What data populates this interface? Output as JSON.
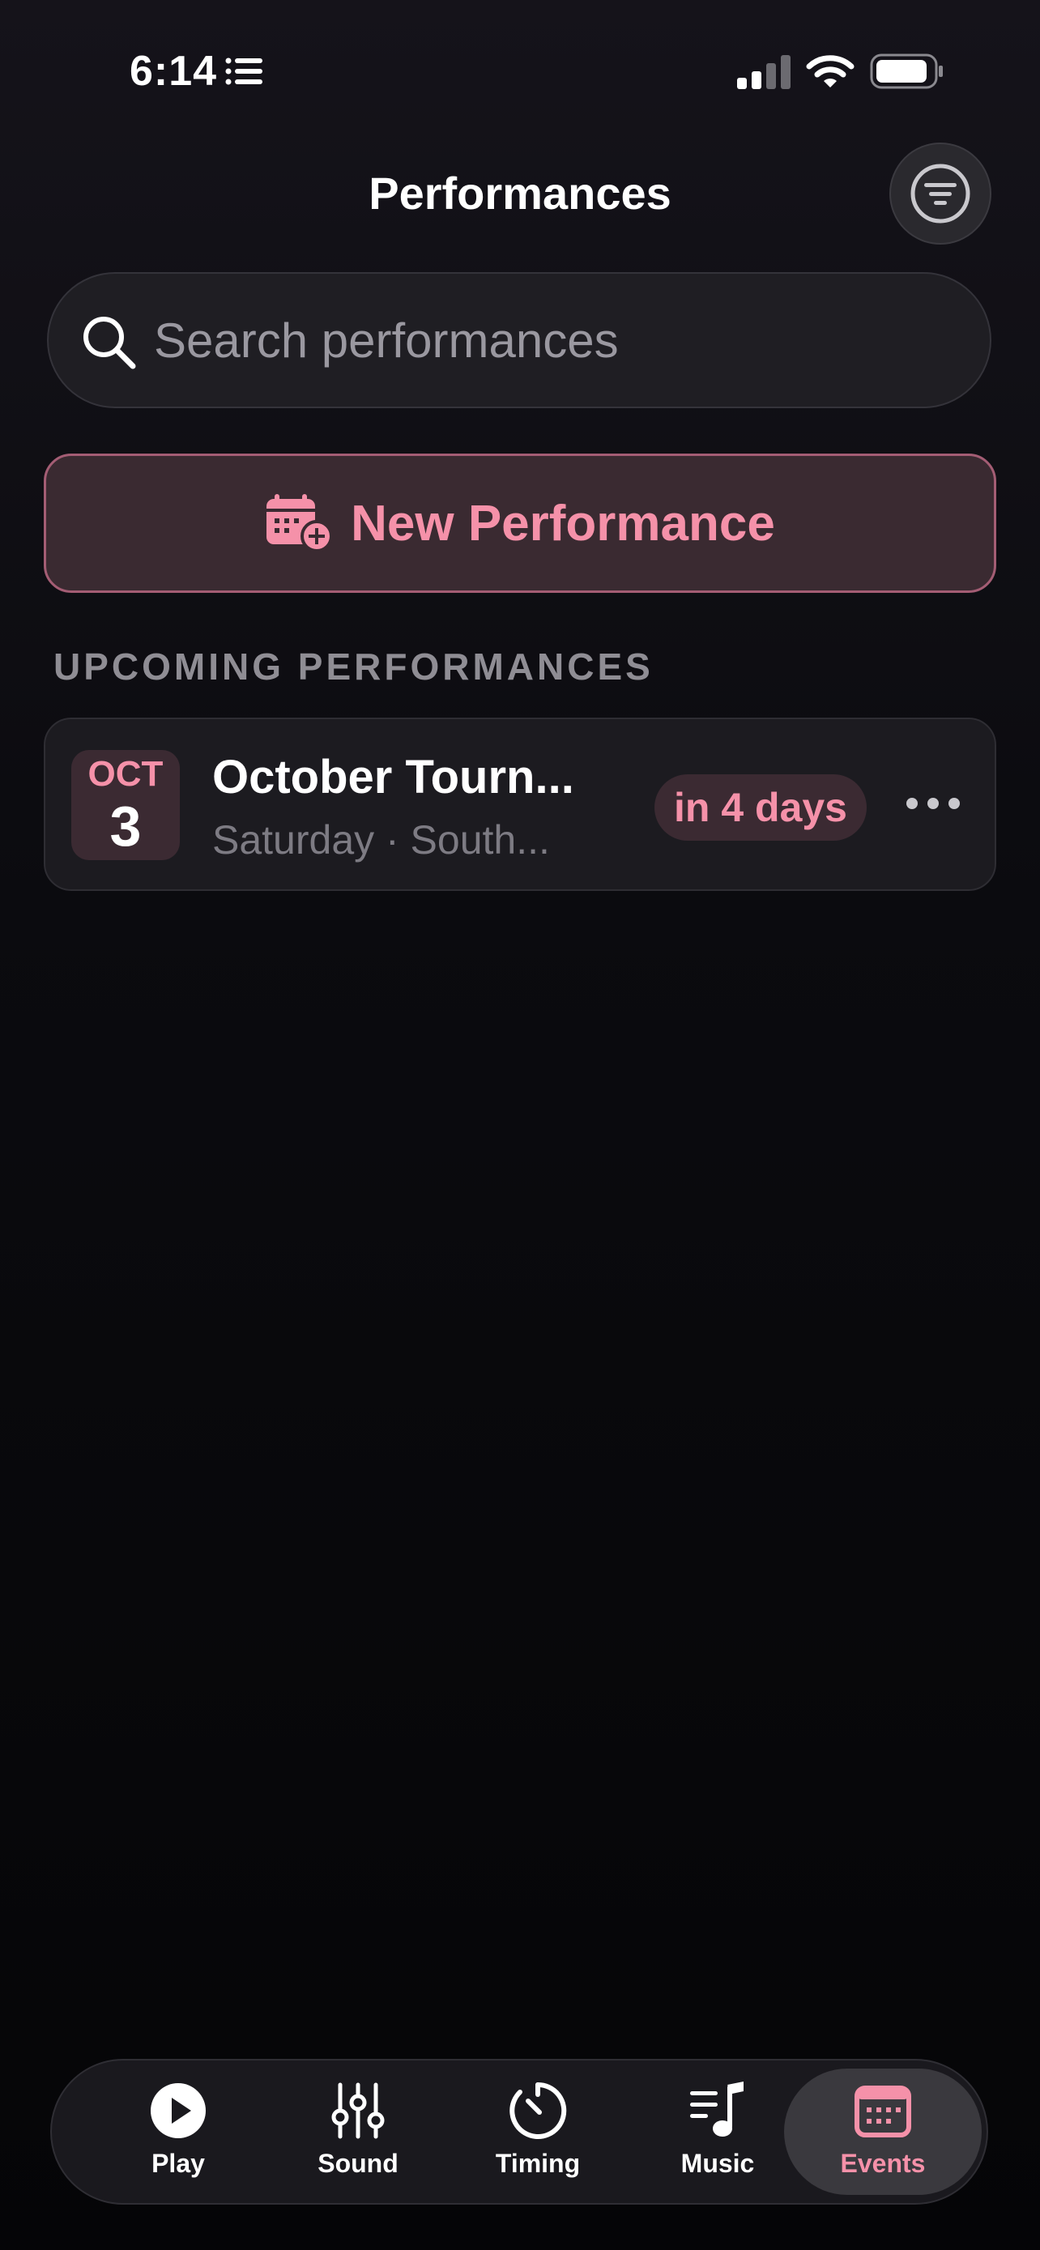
{
  "status_bar": {
    "time": "6:14"
  },
  "header": {
    "title": "Performances"
  },
  "search": {
    "placeholder": "Search performances"
  },
  "new_performance": {
    "label": "New Performance"
  },
  "sections": {
    "upcoming": "UPCOMING PERFORMANCES"
  },
  "performances": [
    {
      "month": "OCT",
      "day": "3",
      "title": "October Tourn...",
      "subtitle": "Saturday · South...",
      "countdown": "in 4 days"
    }
  ],
  "tabs": [
    {
      "label": "Play",
      "icon": "play-circle-icon"
    },
    {
      "label": "Sound",
      "icon": "sliders-icon"
    },
    {
      "label": "Timing",
      "icon": "timer-icon"
    },
    {
      "label": "Music",
      "icon": "music-list-icon"
    },
    {
      "label": "Events",
      "icon": "calendar-icon",
      "active": true
    }
  ],
  "colors": {
    "accent": "#f591a9",
    "background": "#0b0b0f",
    "card": "#1c1b20"
  }
}
